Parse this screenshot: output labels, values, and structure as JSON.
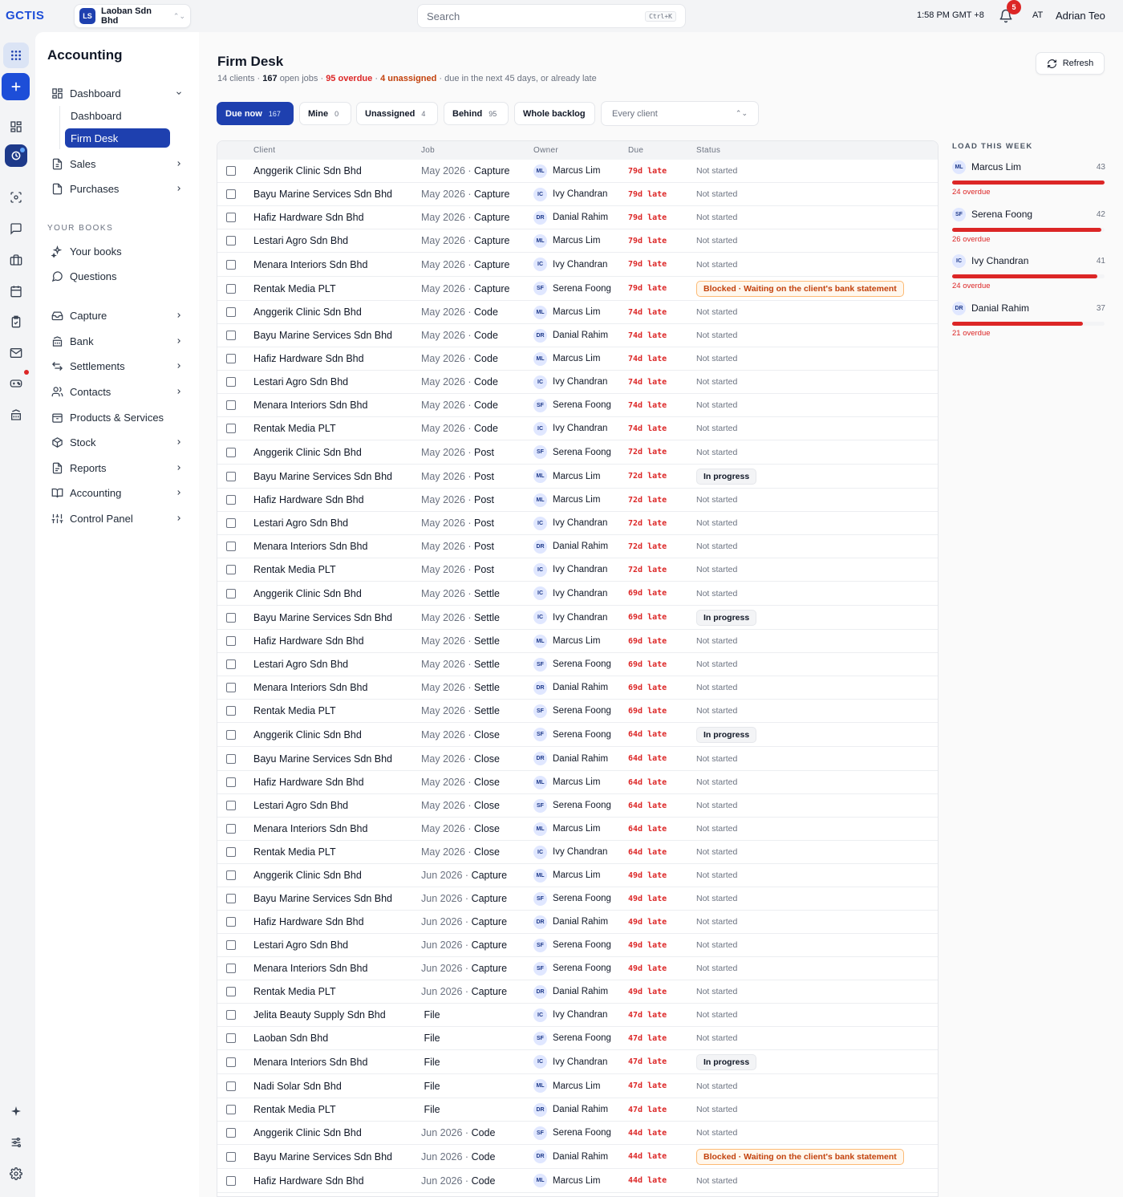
{
  "topbar": {
    "logo_text": "GCTIS",
    "company_badge": "LS",
    "company_name": "Laoban Sdn Bhd",
    "search_placeholder": "Search",
    "search_shortcut": "Ctrl+K",
    "time": "1:58 PM GMT +8",
    "notification_count": "5",
    "user_initials": "AT",
    "user_name": "Adrian Teo"
  },
  "sidebar": {
    "title": "Accounting",
    "dashboard_group": "Dashboard",
    "sub_items": [
      "Dashboard",
      "Firm Desk"
    ],
    "items_top": [
      "Sales",
      "Purchases"
    ],
    "section_label": "YOUR BOOKS",
    "books_items": [
      "Your books",
      "Questions"
    ],
    "items_bottom": [
      "Capture",
      "Bank",
      "Settlements",
      "Contacts",
      "Products & Services",
      "Stock",
      "Reports",
      "Accounting",
      "Control Panel"
    ]
  },
  "page": {
    "title": "Firm Desk",
    "clients": "14 clients",
    "open_jobs": "167",
    "open_jobs_label": "open jobs",
    "overdue": "95 overdue",
    "unassigned": "4 unassigned",
    "due_text": "due in the next 45 days, or already late",
    "refresh_label": "Refresh"
  },
  "filters": [
    {
      "label": "Due now",
      "count": "167"
    },
    {
      "label": "Mine",
      "count": "0"
    },
    {
      "label": "Unassigned",
      "count": "4"
    },
    {
      "label": "Behind",
      "count": "95"
    },
    {
      "label": "Whole backlog",
      "count": ""
    }
  ],
  "client_select": "Every client",
  "table": {
    "columns": [
      "Client",
      "Job",
      "Owner",
      "Due",
      "Status"
    ],
    "rows": [
      {
        "client": "Anggerik Clinic Sdn Bhd",
        "period": "May 2026 · ",
        "stage": "Capture",
        "owner_initials": "ML",
        "owner": "Marcus Lim",
        "due": "79d late",
        "status": "Not started",
        "status_type": "plain"
      },
      {
        "client": "Bayu Marine Services Sdn Bhd",
        "period": "May 2026 · ",
        "stage": "Capture",
        "owner_initials": "IC",
        "owner": "Ivy Chandran",
        "due": "79d late",
        "status": "Not started",
        "status_type": "plain"
      },
      {
        "client": "Hafiz Hardware Sdn Bhd",
        "period": "May 2026 · ",
        "stage": "Capture",
        "owner_initials": "DR",
        "owner": "Danial Rahim",
        "due": "79d late",
        "status": "Not started",
        "status_type": "plain"
      },
      {
        "client": "Lestari Agro Sdn Bhd",
        "period": "May 2026 · ",
        "stage": "Capture",
        "owner_initials": "ML",
        "owner": "Marcus Lim",
        "due": "79d late",
        "status": "Not started",
        "status_type": "plain"
      },
      {
        "client": "Menara Interiors Sdn Bhd",
        "period": "May 2026 · ",
        "stage": "Capture",
        "owner_initials": "IC",
        "owner": "Ivy Chandran",
        "due": "79d late",
        "status": "Not started",
        "status_type": "plain"
      },
      {
        "client": "Rentak Media PLT",
        "period": "May 2026 · ",
        "stage": "Capture",
        "owner_initials": "SF",
        "owner": "Serena Foong",
        "due": "79d late",
        "status": "Blocked · Waiting on the client's bank statement",
        "status_type": "blocked"
      },
      {
        "client": "Anggerik Clinic Sdn Bhd",
        "period": "May 2026 · ",
        "stage": "Code",
        "owner_initials": "ML",
        "owner": "Marcus Lim",
        "due": "74d late",
        "status": "Not started",
        "status_type": "plain"
      },
      {
        "client": "Bayu Marine Services Sdn Bhd",
        "period": "May 2026 · ",
        "stage": "Code",
        "owner_initials": "DR",
        "owner": "Danial Rahim",
        "due": "74d late",
        "status": "Not started",
        "status_type": "plain"
      },
      {
        "client": "Hafiz Hardware Sdn Bhd",
        "period": "May 2026 · ",
        "stage": "Code",
        "owner_initials": "ML",
        "owner": "Marcus Lim",
        "due": "74d late",
        "status": "Not started",
        "status_type": "plain"
      },
      {
        "client": "Lestari Agro Sdn Bhd",
        "period": "May 2026 · ",
        "stage": "Code",
        "owner_initials": "IC",
        "owner": "Ivy Chandran",
        "due": "74d late",
        "status": "Not started",
        "status_type": "plain"
      },
      {
        "client": "Menara Interiors Sdn Bhd",
        "period": "May 2026 · ",
        "stage": "Code",
        "owner_initials": "SF",
        "owner": "Serena Foong",
        "due": "74d late",
        "status": "Not started",
        "status_type": "plain"
      },
      {
        "client": "Rentak Media PLT",
        "period": "May 2026 · ",
        "stage": "Code",
        "owner_initials": "IC",
        "owner": "Ivy Chandran",
        "due": "74d late",
        "status": "Not started",
        "status_type": "plain"
      },
      {
        "client": "Anggerik Clinic Sdn Bhd",
        "period": "May 2026 · ",
        "stage": "Post",
        "owner_initials": "SF",
        "owner": "Serena Foong",
        "due": "72d late",
        "status": "Not started",
        "status_type": "plain"
      },
      {
        "client": "Bayu Marine Services Sdn Bhd",
        "period": "May 2026 · ",
        "stage": "Post",
        "owner_initials": "ML",
        "owner": "Marcus Lim",
        "due": "72d late",
        "status": "In progress",
        "status_type": "progress"
      },
      {
        "client": "Hafiz Hardware Sdn Bhd",
        "period": "May 2026 · ",
        "stage": "Post",
        "owner_initials": "ML",
        "owner": "Marcus Lim",
        "due": "72d late",
        "status": "Not started",
        "status_type": "plain"
      },
      {
        "client": "Lestari Agro Sdn Bhd",
        "period": "May 2026 · ",
        "stage": "Post",
        "owner_initials": "IC",
        "owner": "Ivy Chandran",
        "due": "72d late",
        "status": "Not started",
        "status_type": "plain"
      },
      {
        "client": "Menara Interiors Sdn Bhd",
        "period": "May 2026 · ",
        "stage": "Post",
        "owner_initials": "DR",
        "owner": "Danial Rahim",
        "due": "72d late",
        "status": "Not started",
        "status_type": "plain"
      },
      {
        "client": "Rentak Media PLT",
        "period": "May 2026 · ",
        "stage": "Post",
        "owner_initials": "IC",
        "owner": "Ivy Chandran",
        "due": "72d late",
        "status": "Not started",
        "status_type": "plain"
      },
      {
        "client": "Anggerik Clinic Sdn Bhd",
        "period": "May 2026 · ",
        "stage": "Settle",
        "owner_initials": "IC",
        "owner": "Ivy Chandran",
        "due": "69d late",
        "status": "Not started",
        "status_type": "plain"
      },
      {
        "client": "Bayu Marine Services Sdn Bhd",
        "period": "May 2026 · ",
        "stage": "Settle",
        "owner_initials": "IC",
        "owner": "Ivy Chandran",
        "due": "69d late",
        "status": "In progress",
        "status_type": "progress"
      },
      {
        "client": "Hafiz Hardware Sdn Bhd",
        "period": "May 2026 · ",
        "stage": "Settle",
        "owner_initials": "ML",
        "owner": "Marcus Lim",
        "due": "69d late",
        "status": "Not started",
        "status_type": "plain"
      },
      {
        "client": "Lestari Agro Sdn Bhd",
        "period": "May 2026 · ",
        "stage": "Settle",
        "owner_initials": "SF",
        "owner": "Serena Foong",
        "due": "69d late",
        "status": "Not started",
        "status_type": "plain"
      },
      {
        "client": "Menara Interiors Sdn Bhd",
        "period": "May 2026 · ",
        "stage": "Settle",
        "owner_initials": "DR",
        "owner": "Danial Rahim",
        "due": "69d late",
        "status": "Not started",
        "status_type": "plain"
      },
      {
        "client": "Rentak Media PLT",
        "period": "May 2026 · ",
        "stage": "Settle",
        "owner_initials": "SF",
        "owner": "Serena Foong",
        "due": "69d late",
        "status": "Not started",
        "status_type": "plain"
      },
      {
        "client": "Anggerik Clinic Sdn Bhd",
        "period": "May 2026 · ",
        "stage": "Close",
        "owner_initials": "SF",
        "owner": "Serena Foong",
        "due": "64d late",
        "status": "In progress",
        "status_type": "progress"
      },
      {
        "client": "Bayu Marine Services Sdn Bhd",
        "period": "May 2026 · ",
        "stage": "Close",
        "owner_initials": "DR",
        "owner": "Danial Rahim",
        "due": "64d late",
        "status": "Not started",
        "status_type": "plain"
      },
      {
        "client": "Hafiz Hardware Sdn Bhd",
        "period": "May 2026 · ",
        "stage": "Close",
        "owner_initials": "ML",
        "owner": "Marcus Lim",
        "due": "64d late",
        "status": "Not started",
        "status_type": "plain"
      },
      {
        "client": "Lestari Agro Sdn Bhd",
        "period": "May 2026 · ",
        "stage": "Close",
        "owner_initials": "SF",
        "owner": "Serena Foong",
        "due": "64d late",
        "status": "Not started",
        "status_type": "plain"
      },
      {
        "client": "Menara Interiors Sdn Bhd",
        "period": "May 2026 · ",
        "stage": "Close",
        "owner_initials": "ML",
        "owner": "Marcus Lim",
        "due": "64d late",
        "status": "Not started",
        "status_type": "plain"
      },
      {
        "client": "Rentak Media PLT",
        "period": "May 2026 · ",
        "stage": "Close",
        "owner_initials": "IC",
        "owner": "Ivy Chandran",
        "due": "64d late",
        "status": "Not started",
        "status_type": "plain"
      },
      {
        "client": "Anggerik Clinic Sdn Bhd",
        "period": "Jun 2026 · ",
        "stage": "Capture",
        "owner_initials": "ML",
        "owner": "Marcus Lim",
        "due": "49d late",
        "status": "Not started",
        "status_type": "plain"
      },
      {
        "client": "Bayu Marine Services Sdn Bhd",
        "period": "Jun 2026 · ",
        "stage": "Capture",
        "owner_initials": "SF",
        "owner": "Serena Foong",
        "due": "49d late",
        "status": "Not started",
        "status_type": "plain"
      },
      {
        "client": "Hafiz Hardware Sdn Bhd",
        "period": "Jun 2026 · ",
        "stage": "Capture",
        "owner_initials": "DR",
        "owner": "Danial Rahim",
        "due": "49d late",
        "status": "Not started",
        "status_type": "plain"
      },
      {
        "client": "Lestari Agro Sdn Bhd",
        "period": "Jun 2026 · ",
        "stage": "Capture",
        "owner_initials": "SF",
        "owner": "Serena Foong",
        "due": "49d late",
        "status": "Not started",
        "status_type": "plain"
      },
      {
        "client": "Menara Interiors Sdn Bhd",
        "period": "Jun 2026 · ",
        "stage": "Capture",
        "owner_initials": "SF",
        "owner": "Serena Foong",
        "due": "49d late",
        "status": "Not started",
        "status_type": "plain"
      },
      {
        "client": "Rentak Media PLT",
        "period": "Jun 2026 · ",
        "stage": "Capture",
        "owner_initials": "DR",
        "owner": "Danial Rahim",
        "due": "49d late",
        "status": "Not started",
        "status_type": "plain"
      },
      {
        "client": "Jelita Beauty Supply Sdn Bhd",
        "period": "",
        "stage": "File",
        "owner_initials": "IC",
        "owner": "Ivy Chandran",
        "due": "47d late",
        "status": "Not started",
        "status_type": "plain"
      },
      {
        "client": "Laoban Sdn Bhd",
        "period": "",
        "stage": "File",
        "owner_initials": "SF",
        "owner": "Serena Foong",
        "due": "47d late",
        "status": "Not started",
        "status_type": "plain"
      },
      {
        "client": "Menara Interiors Sdn Bhd",
        "period": "",
        "stage": "File",
        "owner_initials": "IC",
        "owner": "Ivy Chandran",
        "due": "47d late",
        "status": "In progress",
        "status_type": "progress"
      },
      {
        "client": "Nadi Solar Sdn Bhd",
        "period": "",
        "stage": "File",
        "owner_initials": "ML",
        "owner": "Marcus Lim",
        "due": "47d late",
        "status": "Not started",
        "status_type": "plain"
      },
      {
        "client": "Rentak Media PLT",
        "period": "",
        "stage": "File",
        "owner_initials": "DR",
        "owner": "Danial Rahim",
        "due": "47d late",
        "status": "Not started",
        "status_type": "plain"
      },
      {
        "client": "Anggerik Clinic Sdn Bhd",
        "period": "Jun 2026 · ",
        "stage": "Code",
        "owner_initials": "SF",
        "owner": "Serena Foong",
        "due": "44d late",
        "status": "Not started",
        "status_type": "plain"
      },
      {
        "client": "Bayu Marine Services Sdn Bhd",
        "period": "Jun 2026 · ",
        "stage": "Code",
        "owner_initials": "DR",
        "owner": "Danial Rahim",
        "due": "44d late",
        "status": "Blocked · Waiting on the client's bank statement",
        "status_type": "blocked"
      },
      {
        "client": "Hafiz Hardware Sdn Bhd",
        "period": "Jun 2026 · ",
        "stage": "Code",
        "owner_initials": "ML",
        "owner": "Marcus Lim",
        "due": "44d late",
        "status": "Not started",
        "status_type": "plain"
      }
    ]
  },
  "load": {
    "title": "LOAD THIS WEEK",
    "scale_max": 43,
    "people": [
      {
        "initials": "ML",
        "name": "Marcus Lim",
        "count": 43,
        "overdue": "24 overdue"
      },
      {
        "initials": "SF",
        "name": "Serena Foong",
        "count": 42,
        "overdue": "26 overdue"
      },
      {
        "initials": "IC",
        "name": "Ivy Chandran",
        "count": 41,
        "overdue": "24 overdue"
      },
      {
        "initials": "DR",
        "name": "Danial Rahim",
        "count": 37,
        "overdue": "21 overdue"
      }
    ]
  }
}
